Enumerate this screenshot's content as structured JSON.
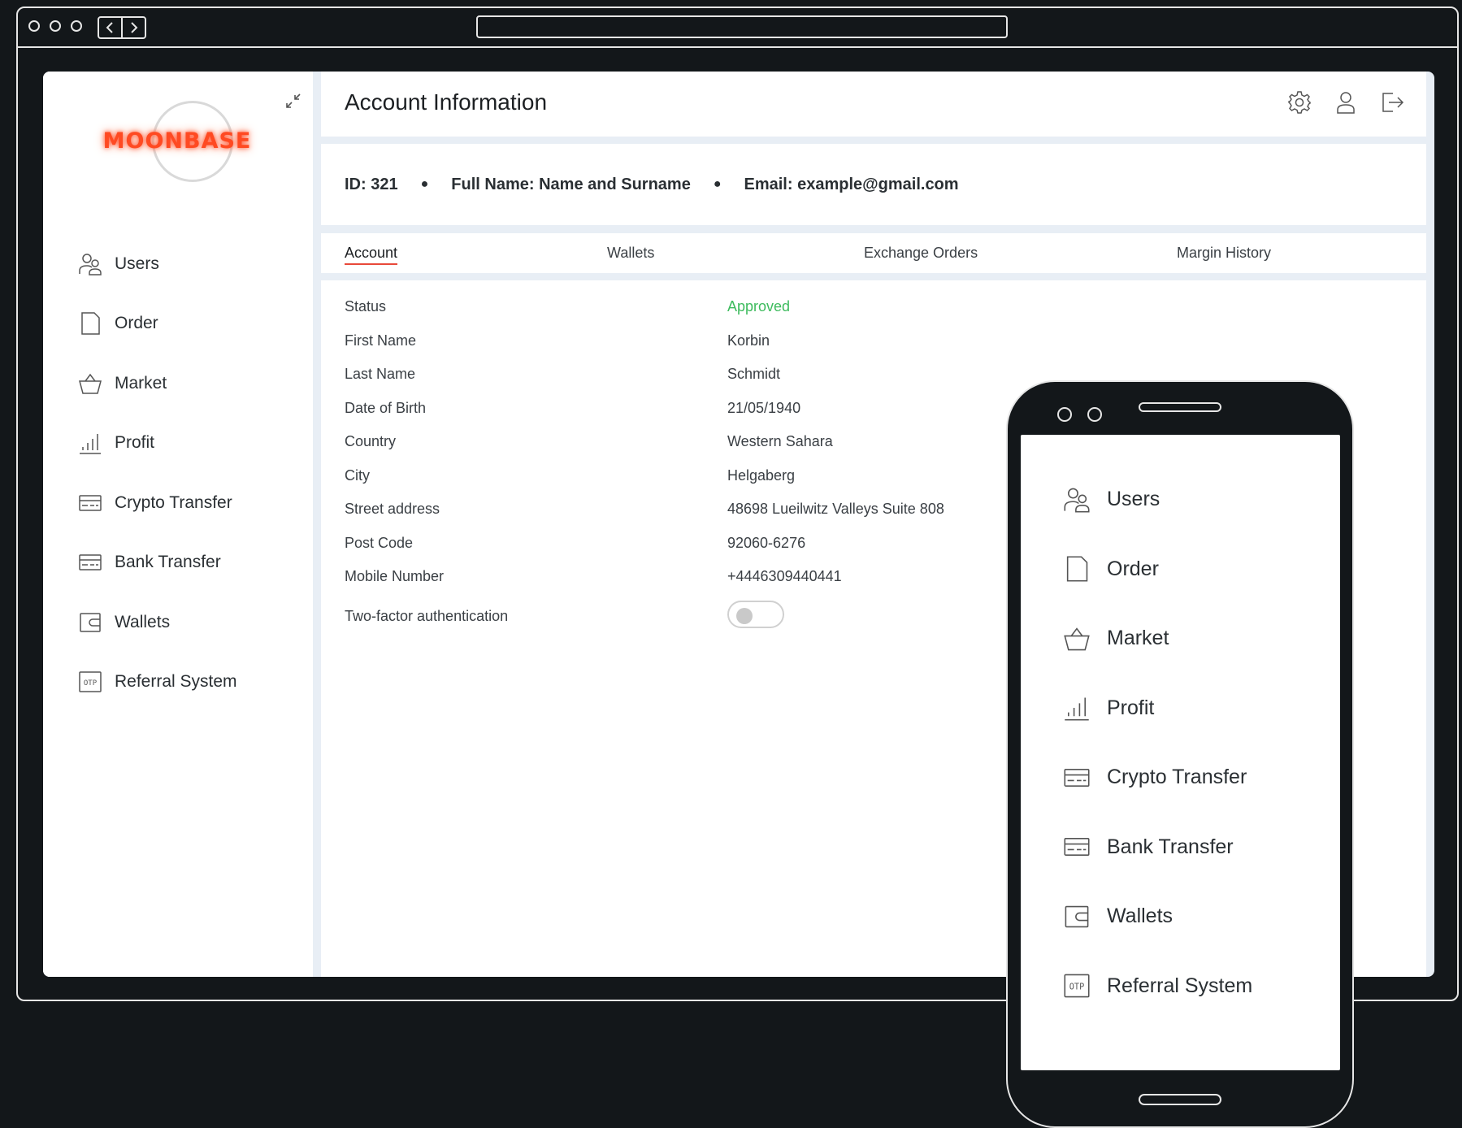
{
  "app": {
    "logo_text": "MOONBASE",
    "title": "Account Information",
    "colors": {
      "accent": "#e8493a",
      "approved": "#3dbb5d",
      "logo": "#ff4a22"
    }
  },
  "sidebar": {
    "items": [
      {
        "label": "Users",
        "icon": "users-icon"
      },
      {
        "label": "Order",
        "icon": "document-icon"
      },
      {
        "label": "Market",
        "icon": "basket-icon"
      },
      {
        "label": "Profit",
        "icon": "bar-chart-icon"
      },
      {
        "label": "Crypto Transfer",
        "icon": "card-icon"
      },
      {
        "label": "Bank Transfer",
        "icon": "card-icon"
      },
      {
        "label": "Wallets",
        "icon": "wallet-icon"
      },
      {
        "label": "Referral System",
        "icon": "otp-icon"
      }
    ]
  },
  "summary": {
    "id_label": "ID:",
    "id_value": "321",
    "name_label": "Full Name:",
    "name_value": "Name and Surname",
    "email_label": "Email:",
    "email_value": "example@gmail.com"
  },
  "tabs": [
    "Account",
    "Wallets",
    "Exchange Orders",
    "Margin History"
  ],
  "account": {
    "fields": [
      {
        "label": "Status",
        "value": "Approved"
      },
      {
        "label": "First Name",
        "value": "Korbin"
      },
      {
        "label": "Last Name",
        "value": "Schmidt"
      },
      {
        "label": "Date of Birth",
        "value": "21/05/1940"
      },
      {
        "label": "Country",
        "value": "Western Sahara"
      },
      {
        "label": "City",
        "value": "Helgaberg"
      },
      {
        "label": "Street address",
        "value": "48698 Lueilwitz Valleys Suite 808"
      },
      {
        "label": "Post Code",
        "value": "92060-6276"
      },
      {
        "label": "Mobile Number",
        "value": "+4446309440441"
      }
    ],
    "two_factor_label": "Two-factor authentication",
    "two_factor_enabled": false
  }
}
